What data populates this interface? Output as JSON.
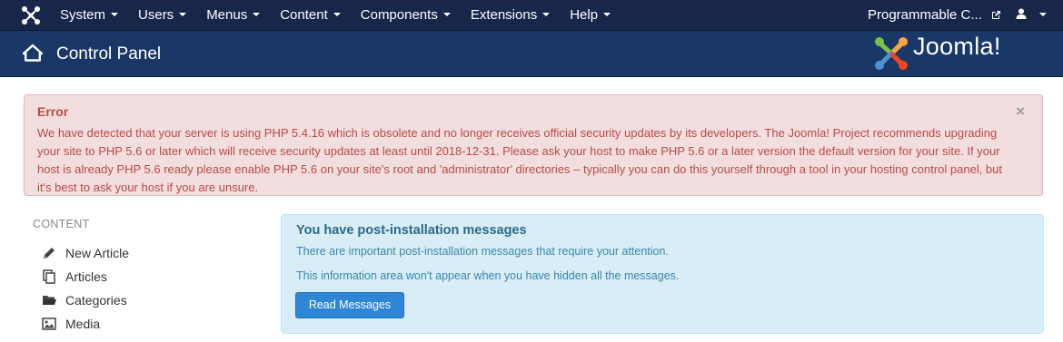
{
  "topnav": {
    "menu": [
      {
        "label": "System"
      },
      {
        "label": "Users"
      },
      {
        "label": "Menus"
      },
      {
        "label": "Content"
      },
      {
        "label": "Components"
      },
      {
        "label": "Extensions"
      },
      {
        "label": "Help"
      }
    ],
    "site_link": "Programmable C...",
    "icons": {
      "brand": "joomla-icon",
      "external": "external-link-icon",
      "user": "user-icon"
    }
  },
  "header": {
    "title": "Control Panel",
    "logo_text": "Joomla!",
    "icons": {
      "home": "home-icon",
      "logo": "joomla-logo"
    }
  },
  "alert": {
    "heading": "Error",
    "close": "×",
    "message": "We have detected that your server is using PHP 5.4.16 which is obsolete and no longer receives official security updates by its developers. The Joomla! Project recommends upgrading your site to PHP 5.6 or later which will receive security updates at least until 2018-12-31. Please ask your host to make PHP 5.6 or a later version the default version for your site. If your host is already PHP 5.6 ready please enable PHP 5.6 on your site's root and 'administrator' directories – typically you can do this yourself through a tool in your hosting control panel, but it's best to ask your host if you are unsure."
  },
  "sidebar": {
    "heading": "CONTENT",
    "items": [
      {
        "label": "New Article",
        "icon": "pencil-icon"
      },
      {
        "label": "Articles",
        "icon": "copy-icon"
      },
      {
        "label": "Categories",
        "icon": "folder-icon"
      },
      {
        "label": "Media",
        "icon": "image-icon"
      }
    ]
  },
  "postinstall": {
    "title": "You have post-installation messages",
    "text1": "There are important post-installation messages that require your attention.",
    "text2": "This information area won't appear when you have hidden all the messages.",
    "button": "Read Messages"
  },
  "colors": {
    "topnav_bg": "#18264a",
    "header_bg": "#1a3867",
    "error_bg": "#f2dede",
    "error_text": "#b94a48",
    "info_bg": "#d9edf7",
    "button_bg": "#2f86d6"
  }
}
